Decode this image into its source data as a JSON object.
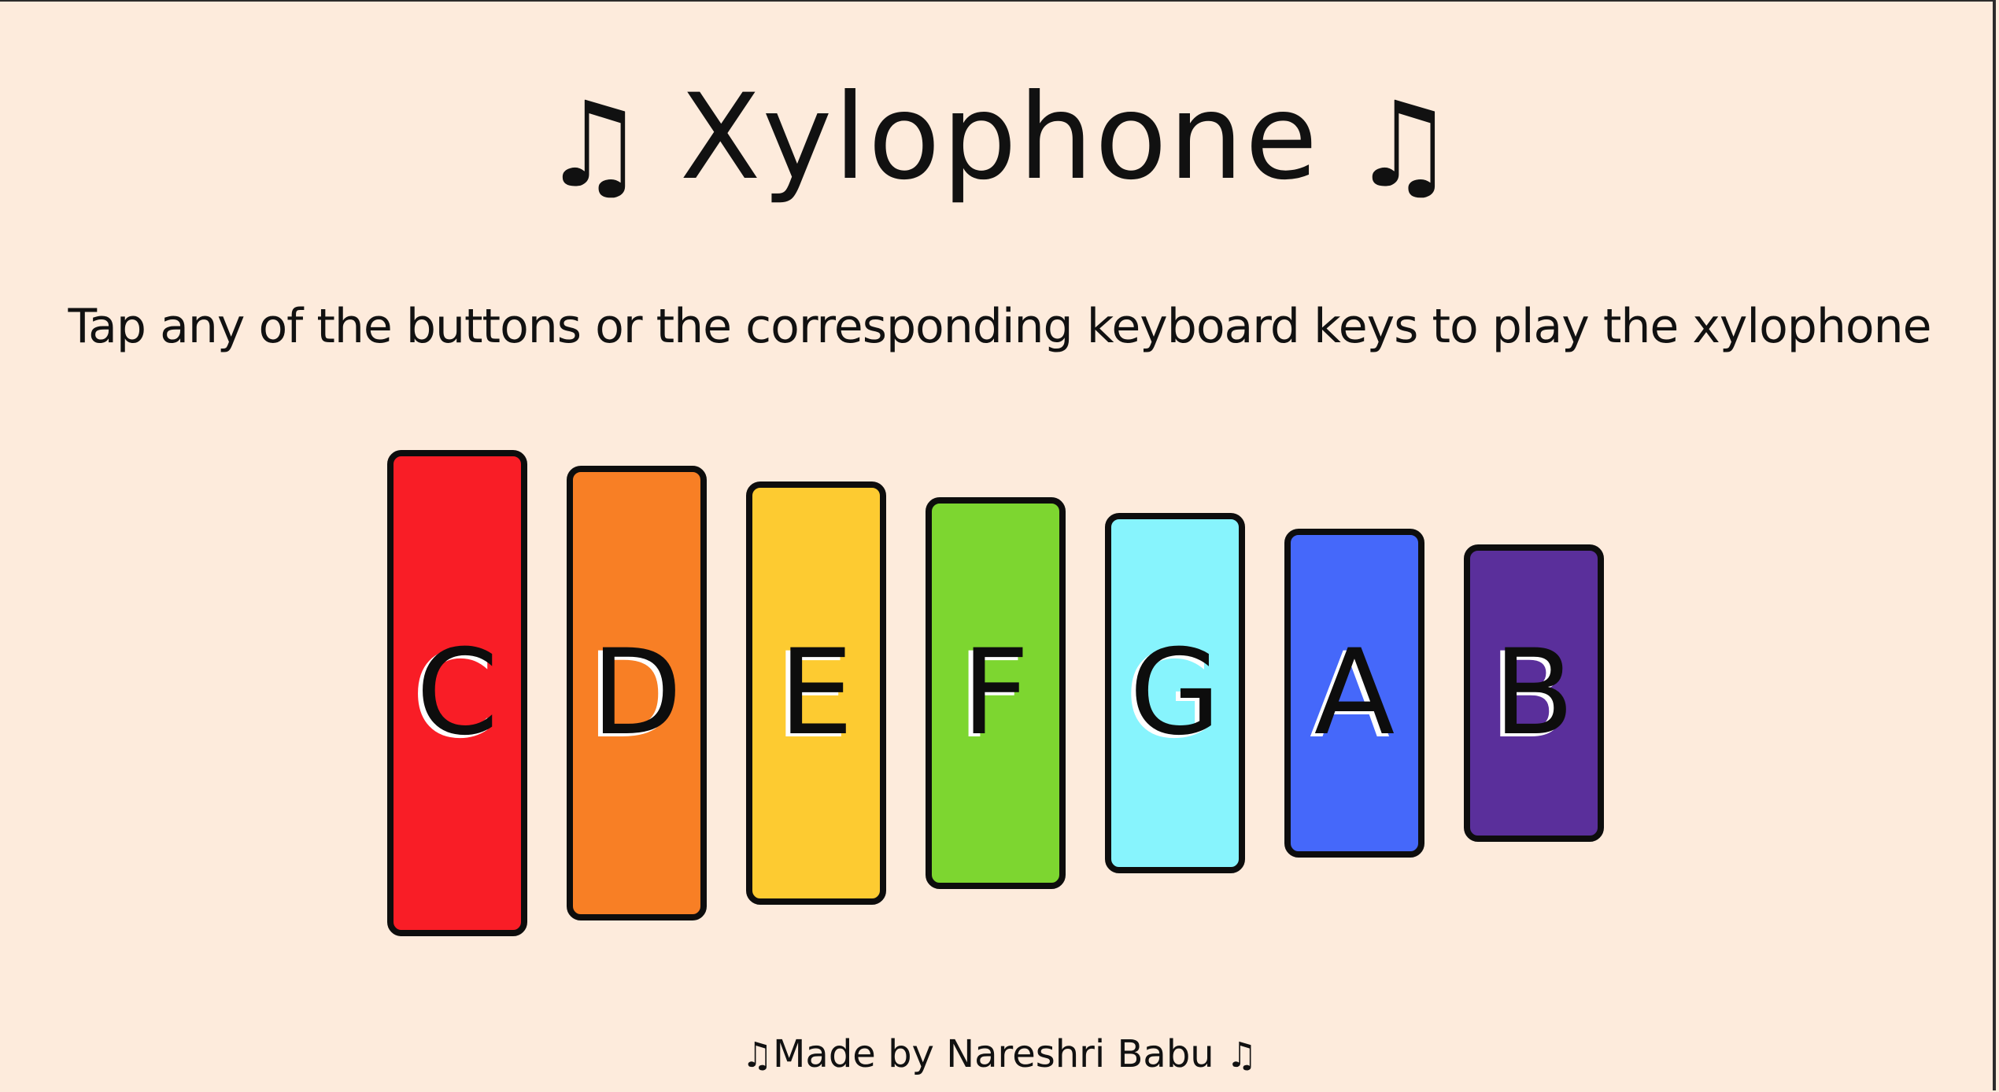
{
  "header": {
    "title": "Xylophone",
    "title_note_icon": "♫"
  },
  "instructions": {
    "text": "Tap any of the buttons or the corresponding keyboard keys to play the xylophone"
  },
  "keys": [
    {
      "label": "C",
      "color": "#f91d26"
    },
    {
      "label": "D",
      "color": "#f87f25"
    },
    {
      "label": "E",
      "color": "#fdcb31"
    },
    {
      "label": "F",
      "color": "#7dd630"
    },
    {
      "label": "G",
      "color": "#87f4fd"
    },
    {
      "label": "A",
      "color": "#4568fa"
    },
    {
      "label": "B",
      "color": "#5a2f9b"
    }
  ],
  "footer": {
    "note_icon": "♫",
    "text": "Made by Nareshri Babu"
  }
}
